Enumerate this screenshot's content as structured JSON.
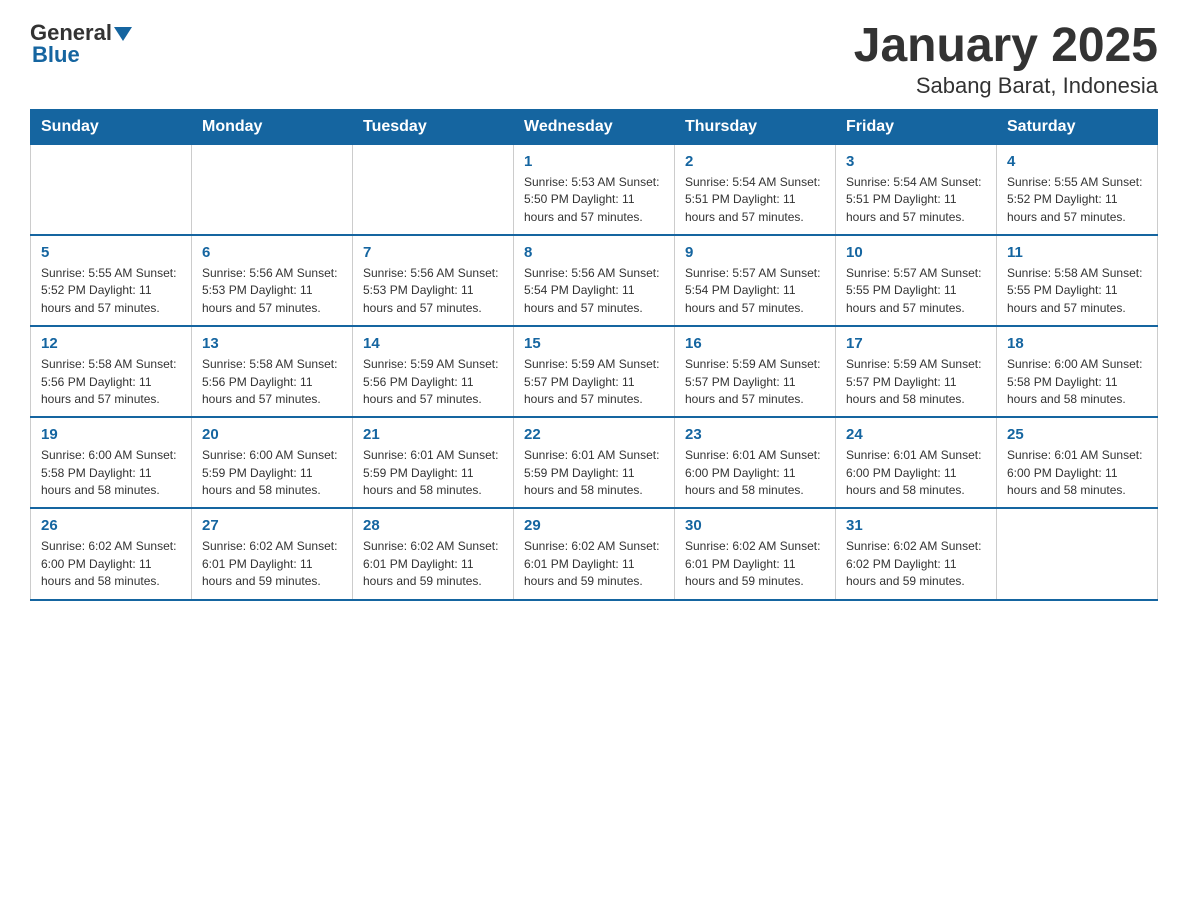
{
  "logo": {
    "general": "General",
    "blue": "Blue"
  },
  "title": "January 2025",
  "subtitle": "Sabang Barat, Indonesia",
  "days_of_week": [
    "Sunday",
    "Monday",
    "Tuesday",
    "Wednesday",
    "Thursday",
    "Friday",
    "Saturday"
  ],
  "weeks": [
    [
      {
        "day": "",
        "info": ""
      },
      {
        "day": "",
        "info": ""
      },
      {
        "day": "",
        "info": ""
      },
      {
        "day": "1",
        "info": "Sunrise: 5:53 AM\nSunset: 5:50 PM\nDaylight: 11 hours and 57 minutes."
      },
      {
        "day": "2",
        "info": "Sunrise: 5:54 AM\nSunset: 5:51 PM\nDaylight: 11 hours and 57 minutes."
      },
      {
        "day": "3",
        "info": "Sunrise: 5:54 AM\nSunset: 5:51 PM\nDaylight: 11 hours and 57 minutes."
      },
      {
        "day": "4",
        "info": "Sunrise: 5:55 AM\nSunset: 5:52 PM\nDaylight: 11 hours and 57 minutes."
      }
    ],
    [
      {
        "day": "5",
        "info": "Sunrise: 5:55 AM\nSunset: 5:52 PM\nDaylight: 11 hours and 57 minutes."
      },
      {
        "day": "6",
        "info": "Sunrise: 5:56 AM\nSunset: 5:53 PM\nDaylight: 11 hours and 57 minutes."
      },
      {
        "day": "7",
        "info": "Sunrise: 5:56 AM\nSunset: 5:53 PM\nDaylight: 11 hours and 57 minutes."
      },
      {
        "day": "8",
        "info": "Sunrise: 5:56 AM\nSunset: 5:54 PM\nDaylight: 11 hours and 57 minutes."
      },
      {
        "day": "9",
        "info": "Sunrise: 5:57 AM\nSunset: 5:54 PM\nDaylight: 11 hours and 57 minutes."
      },
      {
        "day": "10",
        "info": "Sunrise: 5:57 AM\nSunset: 5:55 PM\nDaylight: 11 hours and 57 minutes."
      },
      {
        "day": "11",
        "info": "Sunrise: 5:58 AM\nSunset: 5:55 PM\nDaylight: 11 hours and 57 minutes."
      }
    ],
    [
      {
        "day": "12",
        "info": "Sunrise: 5:58 AM\nSunset: 5:56 PM\nDaylight: 11 hours and 57 minutes."
      },
      {
        "day": "13",
        "info": "Sunrise: 5:58 AM\nSunset: 5:56 PM\nDaylight: 11 hours and 57 minutes."
      },
      {
        "day": "14",
        "info": "Sunrise: 5:59 AM\nSunset: 5:56 PM\nDaylight: 11 hours and 57 minutes."
      },
      {
        "day": "15",
        "info": "Sunrise: 5:59 AM\nSunset: 5:57 PM\nDaylight: 11 hours and 57 minutes."
      },
      {
        "day": "16",
        "info": "Sunrise: 5:59 AM\nSunset: 5:57 PM\nDaylight: 11 hours and 57 minutes."
      },
      {
        "day": "17",
        "info": "Sunrise: 5:59 AM\nSunset: 5:57 PM\nDaylight: 11 hours and 58 minutes."
      },
      {
        "day": "18",
        "info": "Sunrise: 6:00 AM\nSunset: 5:58 PM\nDaylight: 11 hours and 58 minutes."
      }
    ],
    [
      {
        "day": "19",
        "info": "Sunrise: 6:00 AM\nSunset: 5:58 PM\nDaylight: 11 hours and 58 minutes."
      },
      {
        "day": "20",
        "info": "Sunrise: 6:00 AM\nSunset: 5:59 PM\nDaylight: 11 hours and 58 minutes."
      },
      {
        "day": "21",
        "info": "Sunrise: 6:01 AM\nSunset: 5:59 PM\nDaylight: 11 hours and 58 minutes."
      },
      {
        "day": "22",
        "info": "Sunrise: 6:01 AM\nSunset: 5:59 PM\nDaylight: 11 hours and 58 minutes."
      },
      {
        "day": "23",
        "info": "Sunrise: 6:01 AM\nSunset: 6:00 PM\nDaylight: 11 hours and 58 minutes."
      },
      {
        "day": "24",
        "info": "Sunrise: 6:01 AM\nSunset: 6:00 PM\nDaylight: 11 hours and 58 minutes."
      },
      {
        "day": "25",
        "info": "Sunrise: 6:01 AM\nSunset: 6:00 PM\nDaylight: 11 hours and 58 minutes."
      }
    ],
    [
      {
        "day": "26",
        "info": "Sunrise: 6:02 AM\nSunset: 6:00 PM\nDaylight: 11 hours and 58 minutes."
      },
      {
        "day": "27",
        "info": "Sunrise: 6:02 AM\nSunset: 6:01 PM\nDaylight: 11 hours and 59 minutes."
      },
      {
        "day": "28",
        "info": "Sunrise: 6:02 AM\nSunset: 6:01 PM\nDaylight: 11 hours and 59 minutes."
      },
      {
        "day": "29",
        "info": "Sunrise: 6:02 AM\nSunset: 6:01 PM\nDaylight: 11 hours and 59 minutes."
      },
      {
        "day": "30",
        "info": "Sunrise: 6:02 AM\nSunset: 6:01 PM\nDaylight: 11 hours and 59 minutes."
      },
      {
        "day": "31",
        "info": "Sunrise: 6:02 AM\nSunset: 6:02 PM\nDaylight: 11 hours and 59 minutes."
      },
      {
        "day": "",
        "info": ""
      }
    ]
  ]
}
